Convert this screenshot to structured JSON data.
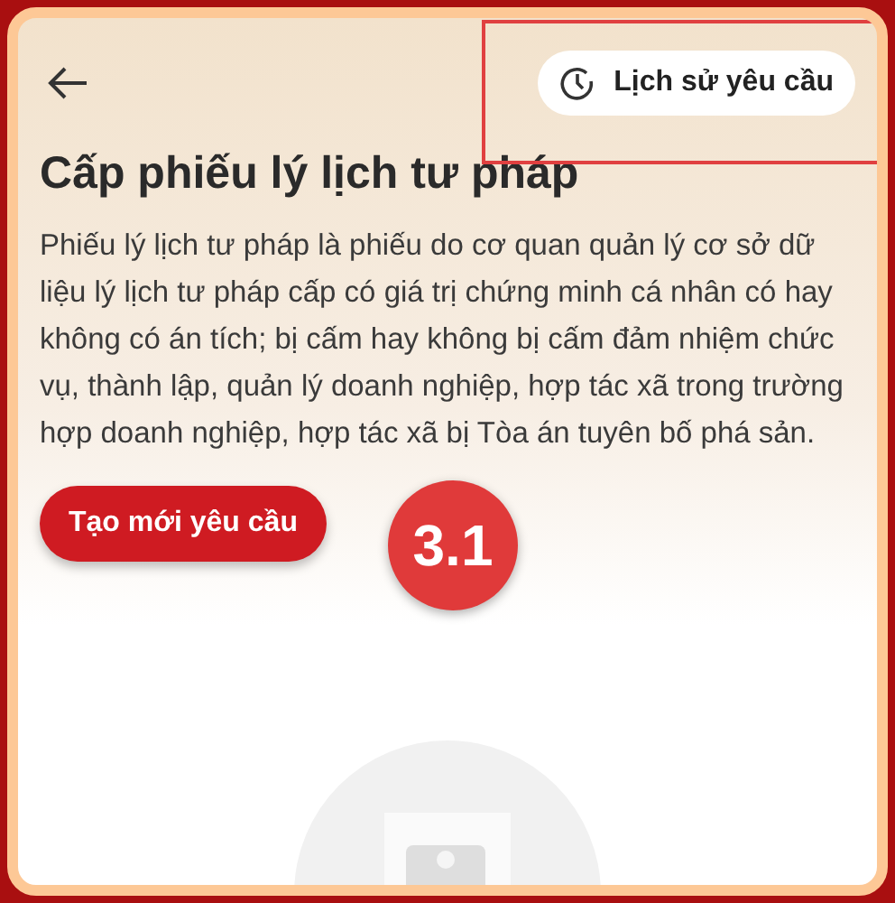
{
  "header": {
    "history_button": {
      "label": "Lịch sử yêu cầu"
    }
  },
  "title": "Cấp phiếu lý lịch tư pháp",
  "description": "Phiếu lý lịch tư pháp là phiếu do cơ quan quản lý cơ sở dữ liệu lý lịch tư pháp cấp có giá trị chứng minh cá nhân có hay không có án tích; bị cấm hay không bị cấm đảm nhiệm chức vụ, thành lập, quản lý doanh nghiệp, hợp tác xã trong trường hợp doanh nghiệp, hợp tác xã bị Tòa án tuyên bố phá sản.",
  "primary_button": {
    "label": "Tạo mới yêu cầu"
  },
  "annotation": {
    "label": "3.1"
  }
}
